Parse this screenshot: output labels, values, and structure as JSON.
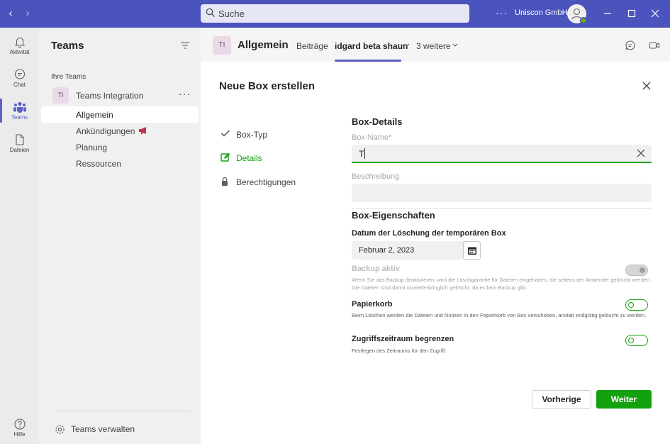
{
  "titlebar": {
    "search_placeholder": "Suche",
    "more": "···",
    "org": "Uniscon GmbH"
  },
  "rail": [
    {
      "label": "Aktivität",
      "icon": "bell-icon"
    },
    {
      "label": "Chat",
      "icon": "chat-icon"
    },
    {
      "label": "Teams",
      "icon": "teams-icon"
    },
    {
      "label": "Dateien",
      "icon": "file-icon"
    },
    {
      "label": "Hilfe",
      "icon": "help-icon"
    }
  ],
  "teams_panel": {
    "title": "Teams",
    "section": "Ihre Teams",
    "team": {
      "initials": "TI",
      "name": "Teams Integration",
      "more": "···"
    },
    "channels": [
      "Allgemein",
      "Ankündigungen",
      "Planung",
      "Ressourcen"
    ],
    "manage": "Teams verwalten"
  },
  "channel_header": {
    "initials": "TI",
    "title": "Allgemein",
    "tabs": [
      "Beiträge",
      "idgard beta shaun",
      "3 weitere"
    ]
  },
  "dialog": {
    "title": "Neue Box erstellen",
    "steps": [
      "Box-Typ",
      "Details",
      "Berechtigungen"
    ],
    "details_title": "Box-Details",
    "name_label": "Box-Name*",
    "name_value": "T",
    "description_label": "Beschreibung",
    "properties_title": "Box-Eigenschaften",
    "deletion_date_label": "Datum der Löschung der temporären Box",
    "deletion_date": "Februar 2, 2023",
    "backup_title": "Backup aktiv",
    "backup_desc": "Wenn Sie das Backup deaktivieren, wird die Löschgarantie für Dateien eingehalten, die seitens der Anwender gelöscht werden. Die Dateien sind damit unwiederbringlich gelöscht, da es kein Backup gibt.",
    "trash_title": "Papierkorb",
    "trash_desc": "Beim Löschen werden die Dateien und Notizen in den Papierkorb von Box verschoben, anstatt endgültig gelöscht zu werden.",
    "access_title": "Zugriffszeitraum begrenzen",
    "access_desc": "Festlegen des Zeitraums für den Zugriff.",
    "back_label": "Vorherige",
    "next_label": "Weiter"
  },
  "colors": {
    "titlebar": "#4b53bc",
    "accent": "#5b5fc7",
    "success": "#13a10e"
  }
}
